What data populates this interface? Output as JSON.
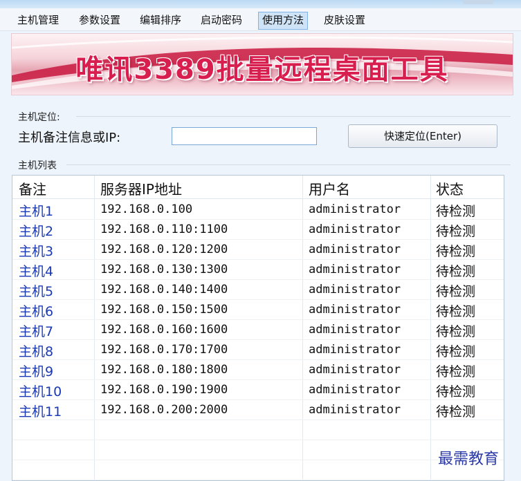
{
  "menu": [
    "主机管理",
    "参数设置",
    "编辑排序",
    "启动密码",
    "使用方法",
    "皮肤设置"
  ],
  "menu_active_index": 4,
  "banner": {
    "title": "唯讯3389批量远程桌面工具"
  },
  "locate": {
    "section_label": "主机定位:",
    "field_label": "主机备注信息或IP:",
    "input_value": "",
    "button_label": "快速定位(Enter)"
  },
  "list": {
    "section_label": "主机列表",
    "columns": [
      "备注",
      "服务器IP地址",
      "用户名",
      "状态"
    ],
    "rows": [
      [
        "主机1",
        "192.168.0.100",
        "administrator",
        "待检测"
      ],
      [
        "主机2",
        "192.168.0.110:1100",
        "administrator",
        "待检测"
      ],
      [
        "主机3",
        "192.168.0.120:1200",
        "administrator",
        "待检测"
      ],
      [
        "主机4",
        "192.168.0.130:1300",
        "administrator",
        "待检测"
      ],
      [
        "主机5",
        "192.168.0.140:1400",
        "administrator",
        "待检测"
      ],
      [
        "主机6",
        "192.168.0.150:1500",
        "administrator",
        "待检测"
      ],
      [
        "主机7",
        "192.168.0.160:1600",
        "administrator",
        "待检测"
      ],
      [
        "主机8",
        "192.168.0.170:1700",
        "administrator",
        "待检测"
      ],
      [
        "主机9",
        "192.168.0.180:1800",
        "administrator",
        "待检测"
      ],
      [
        "主机10",
        "192.168.0.190:1900",
        "administrator",
        "待检测"
      ],
      [
        "主机11",
        "192.168.0.200:2000",
        "administrator",
        "待检测"
      ]
    ]
  },
  "watermark": "最需教育"
}
